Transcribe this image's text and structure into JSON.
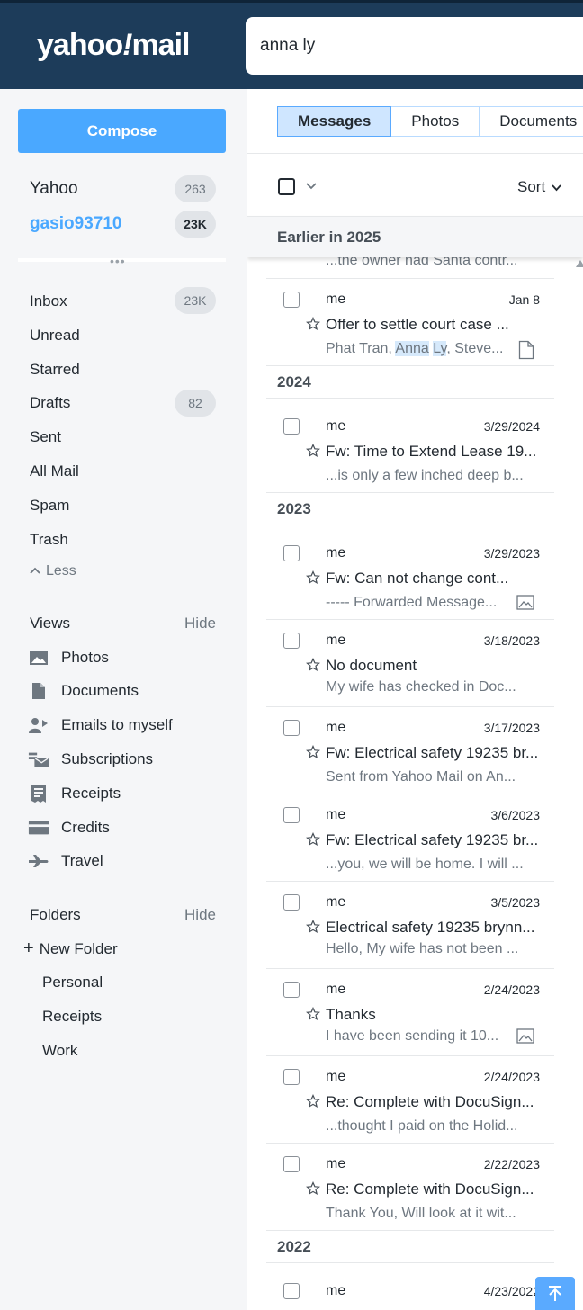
{
  "header": {
    "logo": {
      "word1": "yahoo",
      "slash": "!",
      "word2": "mail"
    },
    "search_value": "anna ly"
  },
  "sidebar": {
    "compose_label": "Compose",
    "accounts": [
      {
        "name": "Yahoo",
        "count": "263"
      },
      {
        "name": "gasio93710",
        "count": "23K"
      }
    ],
    "nav": [
      {
        "label": "Inbox",
        "count": "23K"
      },
      {
        "label": "Unread"
      },
      {
        "label": "Starred"
      },
      {
        "label": "Drafts",
        "count": "82"
      },
      {
        "label": "Sent"
      },
      {
        "label": "All Mail"
      },
      {
        "label": "Spam"
      },
      {
        "label": "Trash"
      }
    ],
    "less_label": "Less",
    "views": {
      "title": "Views",
      "hide_label": "Hide",
      "items": [
        {
          "label": "Photos",
          "icon": "photo-icon"
        },
        {
          "label": "Documents",
          "icon": "document-icon"
        },
        {
          "label": "Emails to myself",
          "icon": "person-icon"
        },
        {
          "label": "Subscriptions",
          "icon": "subscriptions-icon"
        },
        {
          "label": "Receipts",
          "icon": "receipt-icon"
        },
        {
          "label": "Credits",
          "icon": "credit-card-icon"
        },
        {
          "label": "Travel",
          "icon": "airplane-icon"
        }
      ]
    },
    "folders": {
      "title": "Folders",
      "hide_label": "Hide",
      "new_folder_label": "New Folder",
      "items": [
        "Personal",
        "Receipts",
        "Work"
      ]
    }
  },
  "main": {
    "tabs": [
      "Messages",
      "Photos",
      "Documents"
    ],
    "sort_label": "Sort",
    "sticky_group": "Earlier in 2025",
    "partial_snippet": "...the owner had Santa contr...",
    "groups": [
      {
        "year": "",
        "messages": [
          {
            "sender": "me",
            "date": "Jan 8",
            "subject": "Offer to settle court case ...",
            "snippet_parts": [
              "Phat Tran, ",
              "Anna",
              " ",
              "Ly",
              ", Steve..."
            ],
            "attachment": "document"
          }
        ]
      },
      {
        "year": "2024",
        "messages": [
          {
            "sender": "me",
            "date": "3/29/2024",
            "subject": "Fw: Time to Extend Lease 19...",
            "snippet": "...is only a few inched deep b..."
          }
        ]
      },
      {
        "year": "2023",
        "messages": [
          {
            "sender": "me",
            "date": "3/29/2023",
            "subject": "Fw: Can not change cont...",
            "snippet": "----- Forwarded Message...",
            "attachment": "image"
          },
          {
            "sender": "me",
            "date": "3/18/2023",
            "subject": "No document",
            "snippet": "My wife has checked in Doc..."
          },
          {
            "sender": "me",
            "date": "3/17/2023",
            "subject": "Fw: Electrical safety 19235 br...",
            "snippet": "Sent from Yahoo Mail on An..."
          },
          {
            "sender": "me",
            "date": "3/6/2023",
            "subject": "Fw: Electrical safety 19235 br...",
            "snippet": "...you, we will be home. I will ..."
          },
          {
            "sender": "me",
            "date": "3/5/2023",
            "subject": "Electrical safety 19235 brynn...",
            "snippet": "Hello, My wife has not been ..."
          },
          {
            "sender": "me",
            "date": "2/24/2023",
            "subject": "Thanks",
            "snippet": "I have been sending it 10...",
            "attachment": "image"
          },
          {
            "sender": "me",
            "date": "2/24/2023",
            "subject": "Re: Complete with DocuSign...",
            "snippet": "...thought I paid on the Holid..."
          },
          {
            "sender": "me",
            "date": "2/22/2023",
            "subject": "Re: Complete with DocuSign...",
            "snippet": "Thank You, Will look at it wit..."
          }
        ]
      },
      {
        "year": "2022",
        "messages": [
          {
            "sender": "me",
            "date": "4/23/2022"
          }
        ]
      }
    ]
  }
}
